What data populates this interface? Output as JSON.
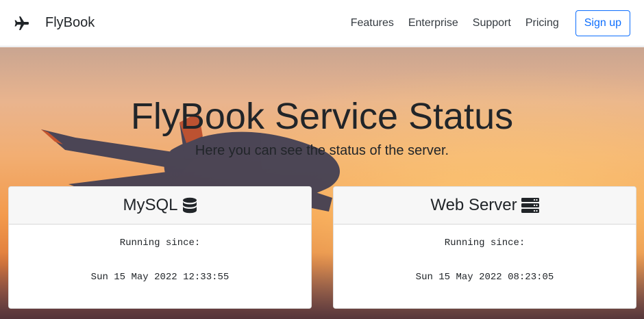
{
  "navbar": {
    "brand_icon": "airplane-icon",
    "brand_name": "FlyBook",
    "links": [
      "Features",
      "Enterprise",
      "Support",
      "Pricing"
    ],
    "signup_label": "Sign up",
    "accent_color": "#0d6efd"
  },
  "hero": {
    "title": "FlyBook Service Status",
    "subtitle": "Here you can see the status of the server."
  },
  "services": [
    {
      "name": "MySQL",
      "icon": "database-icon",
      "label": "Running since:",
      "value": "Sun 15 May 2022 12:33:55"
    },
    {
      "name": "Web Server",
      "icon": "server-icon",
      "label": "Running since:",
      "value": "Sun 15 May 2022 08:23:05"
    }
  ]
}
